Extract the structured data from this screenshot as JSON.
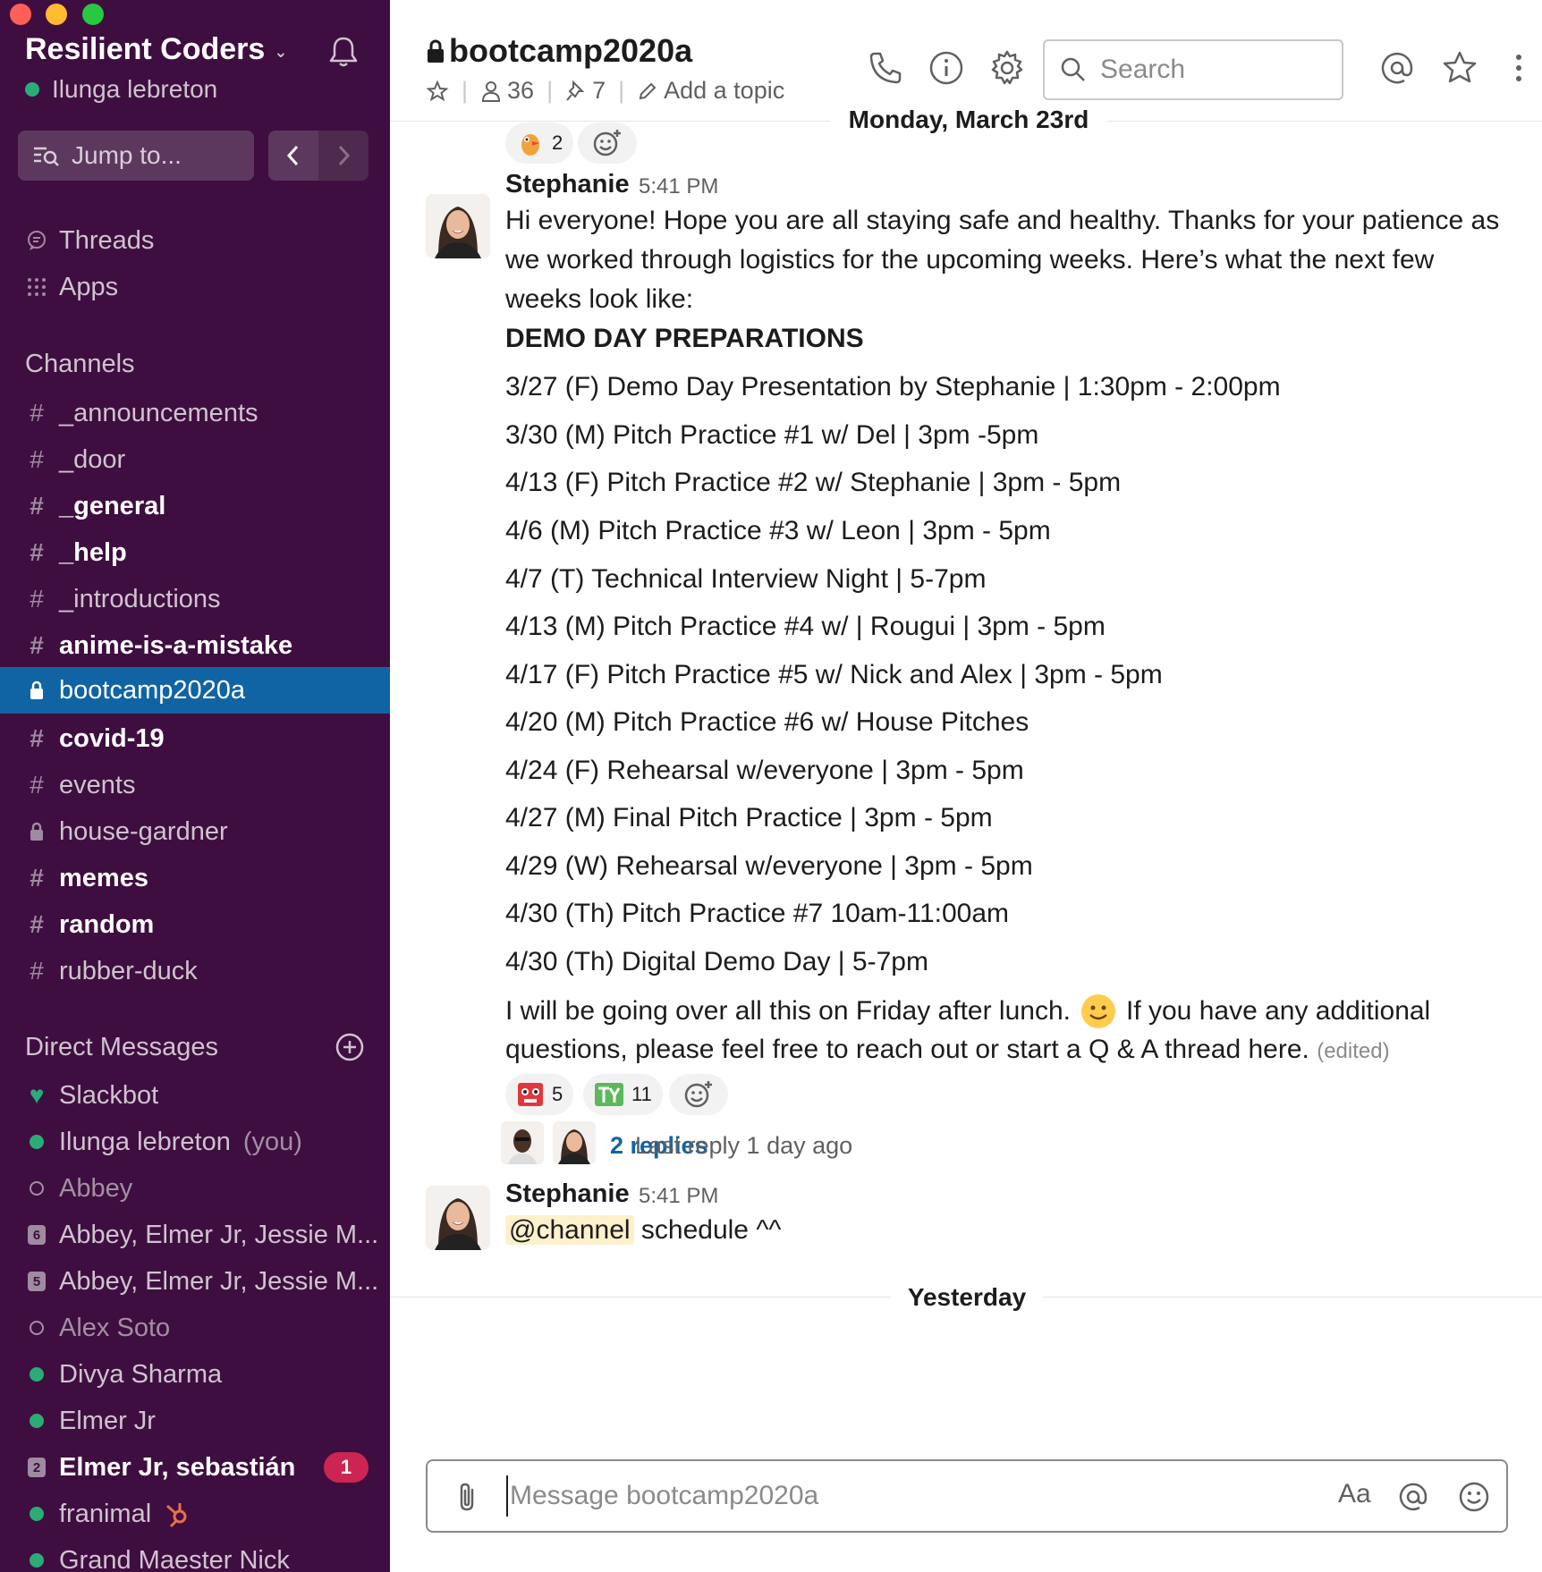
{
  "workspace": {
    "name": "Resilient Coders",
    "user": "Ilunga lebreton"
  },
  "sidebar": {
    "jump_label": "Jump to...",
    "top_items": [
      {
        "label": "Threads",
        "icon": "threads-icon"
      },
      {
        "label": "Apps",
        "icon": "apps-icon"
      }
    ],
    "channels_heading": "Channels",
    "channels": [
      {
        "label": "_announcements",
        "glyph": "#"
      },
      {
        "label": "_door",
        "glyph": "#"
      },
      {
        "label": "_general",
        "glyph": "#"
      },
      {
        "label": "_help",
        "glyph": "#"
      },
      {
        "label": "_introductions",
        "glyph": "#"
      },
      {
        "label": "anime-is-a-mistake",
        "glyph": "#"
      },
      {
        "label": "bootcamp2020a",
        "glyph": "lock"
      },
      {
        "label": "covid-19",
        "glyph": "#"
      },
      {
        "label": "events",
        "glyph": "#"
      },
      {
        "label": "house-gardner",
        "glyph": "lock"
      },
      {
        "label": "memes",
        "glyph": "#"
      },
      {
        "label": "random",
        "glyph": "#"
      },
      {
        "label": "rubber-duck",
        "glyph": "#"
      }
    ],
    "dm_heading": "Direct Messages",
    "dms": [
      {
        "label": "Slackbot"
      },
      {
        "label": "Ilunga lebreton",
        "suffix": "(you)"
      },
      {
        "label": "Abbey"
      },
      {
        "label": "Abbey, Elmer Jr, Jessie M...",
        "count": "6"
      },
      {
        "label": "Abbey, Elmer Jr, Jessie M...",
        "count": "5"
      },
      {
        "label": "Alex Soto"
      },
      {
        "label": "Divya Sharma"
      },
      {
        "label": "Elmer Jr"
      },
      {
        "label": "Elmer Jr, sebastián",
        "count": "2",
        "badge": "1"
      },
      {
        "label": "franimal"
      },
      {
        "label": "Grand Maester Nick"
      }
    ]
  },
  "header": {
    "channel": "bootcamp2020a",
    "members": "36",
    "pins": "7",
    "topic": "Add a topic",
    "search_placeholder": "Search",
    "date": "Monday, March 23rd"
  },
  "messages": {
    "top_reaction_count": "2",
    "msg1": {
      "sender": "Stephanie",
      "time": "5:41 PM",
      "intro": "Hi everyone! Hope you are all staying safe and healthy. Thanks for your patience as we worked through logistics for the upcoming weeks. Here’s what the next few weeks look like:",
      "heading": "DEMO DAY PREPARATIONS",
      "schedule": [
        "3/27 (F) Demo Day Presentation by Stephanie | 1:30pm - 2:00pm",
        "3/30 (M) Pitch Practice #1 w/ Del | 3pm -5pm",
        "4/13 (F) Pitch Practice #2 w/ Stephanie | 3pm - 5pm",
        "4/6 (M) Pitch Practice #3 w/ Leon | 3pm - 5pm",
        "4/7 (T) Technical Interview Night | 5-7pm",
        "4/13 (M) Pitch Practice #4 w/ | Rougui | 3pm - 5pm",
        "4/17 (F) Pitch Practice #5 w/ Nick and Alex | 3pm - 5pm",
        "4/20 (M) Pitch Practice #6 w/ House Pitches",
        "4/24 (F) Rehearsal w/everyone | 3pm - 5pm",
        "4/27 (M) Final Pitch Practice | 3pm - 5pm",
        "4/29 (W) Rehearsal w/everyone  | 3pm - 5pm",
        "4/30 (Th) Pitch Practice #7 10am-11:00am",
        "4/30 (Th) Digital Demo Day | 5-7pm"
      ],
      "closing_1": "I will be going over all this on Friday after lunch.",
      "closing_2": "If you have any additional",
      "closing_3": "questions, please feel free to reach out or start a Q & A thread here.",
      "edited": "(edited)",
      "reaction_1_count": "5",
      "reaction_2_count": "11",
      "replies": "2 replies",
      "last_reply": "Last reply 1 day ago"
    },
    "msg2": {
      "sender": "Stephanie",
      "time": "5:41 PM",
      "mention": "@channel",
      "text": "schedule ^^"
    },
    "yesterday": "Yesterday"
  },
  "composer": {
    "placeholder": "Message bootcamp2020a",
    "format_label": "Aa"
  },
  "colors": {
    "sidebar_bg": "#3f0e40",
    "active_channel": "#1164a3",
    "link": "#1264a3",
    "badge": "#cd2553",
    "online": "#2bac76"
  }
}
